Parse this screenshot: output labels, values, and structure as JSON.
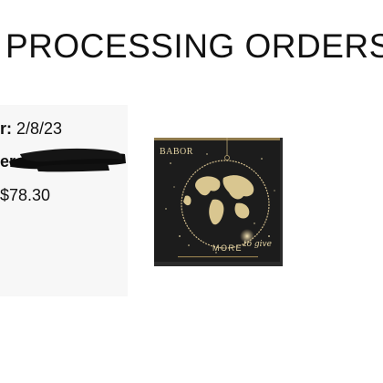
{
  "page": {
    "title": "PROCESSING ORDERS"
  },
  "order": {
    "date_label": "r:",
    "date_value": "2/8/23",
    "number_label": "ers",
    "price": "$78.30"
  },
  "product": {
    "brand": "BABOR",
    "tagline": "MORE",
    "tagline_script": "to give",
    "colors": {
      "box": "#1c1c1c",
      "gold": "#cdb98a"
    }
  }
}
